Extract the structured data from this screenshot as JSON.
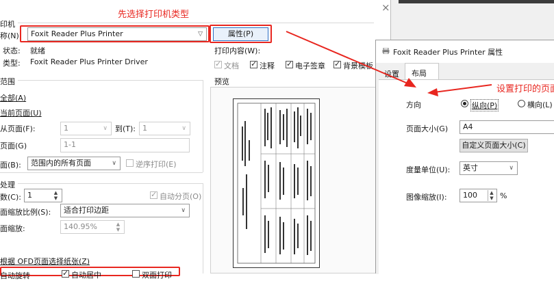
{
  "annotations": {
    "top_note": "先选择打印机类型",
    "right_note": "设置打印的页面"
  },
  "close_symbol": "×",
  "printer": {
    "group_label": "印机",
    "name_label": "称(N):",
    "name_value": "Foxit Reader Plus Printer",
    "properties_button": "属性(P)",
    "status_label": "状态:",
    "status_value": "就绪",
    "type_label": "类型:",
    "type_value": "Foxit Reader Plus Printer Driver"
  },
  "print_content": {
    "label": "打印内容(W):",
    "options": [
      {
        "label": "文档",
        "checked": true,
        "disabled": true
      },
      {
        "label": "注释",
        "checked": true,
        "disabled": false
      },
      {
        "label": "电子签章",
        "checked": true,
        "disabled": false
      },
      {
        "label": "背景模板",
        "checked": true,
        "disabled": false
      }
    ]
  },
  "range": {
    "group_label": "范围",
    "all": "全部(A)",
    "current": "当前页面(U)",
    "from_label": "从页面(F):",
    "from_value": "1",
    "to_label": "到(T):",
    "to_value": "1",
    "pages_label": "页面(G)",
    "pages_value": "1-1",
    "subset_label": "面(B):",
    "subset_value": "范围内的所有页面",
    "reverse": "逆序打印(E)"
  },
  "preview": {
    "label": "预览"
  },
  "handling": {
    "group_label": "处理",
    "copies_label": "数(C):",
    "copies_value": "1",
    "collate": "自动分页(O)",
    "scale_label": "面缩放比例(S):",
    "scale_value": "适合打印边距",
    "zoom_label": "面缩放:",
    "zoom_value": "140.95%",
    "paper_label": "根据 OFD页面选择纸张(Z)",
    "auto_rotate": "自动旋转",
    "auto_center": "自动居中",
    "duplex": "双面打印"
  },
  "properties_dialog": {
    "title": "Foxit Reader Plus Printer 属性",
    "tabs": [
      "设置",
      "布局"
    ],
    "orientation_label": "方向",
    "portrait": "纵向(P)",
    "landscape": "横向(L)",
    "page_size_label": "页面大小(G)",
    "page_size_value": "A4",
    "custom_size_button": "自定义页面大小(C)",
    "unit_label": "度量单位(U):",
    "unit_value": "英寸",
    "scale_label": "图像缩放(I):",
    "scale_value": "100",
    "scale_unit": "%"
  },
  "colors": {
    "annotation_red": "#e8261f",
    "selection_blue": "#2c6fc4"
  }
}
